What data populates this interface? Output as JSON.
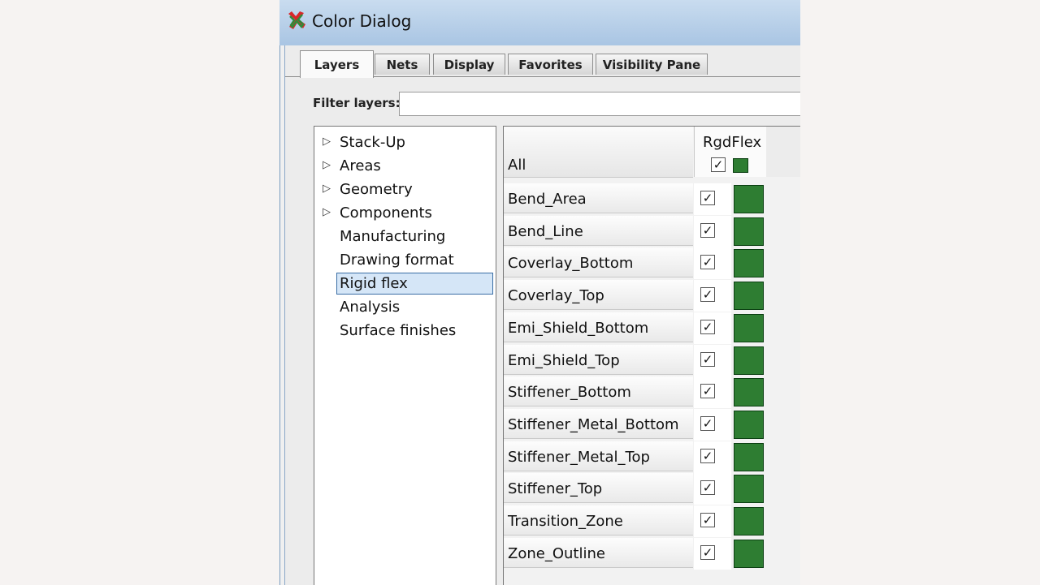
{
  "window": {
    "title": "Color Dialog",
    "icon": "color-palette-icon"
  },
  "tabs": [
    {
      "label": "Layers",
      "active": true
    },
    {
      "label": "Nets",
      "active": false
    },
    {
      "label": "Display",
      "active": false
    },
    {
      "label": "Favorites",
      "active": false
    },
    {
      "label": "Visibility Pane",
      "active": false
    }
  ],
  "filter": {
    "label": "Filter layers:",
    "value": ""
  },
  "tree": {
    "items": [
      {
        "label": "Stack-Up",
        "expandable": true
      },
      {
        "label": "Areas",
        "expandable": true
      },
      {
        "label": "Geometry",
        "expandable": true
      },
      {
        "label": "Components",
        "expandable": true
      },
      {
        "label": "Manufacturing",
        "expandable": false
      },
      {
        "label": "Drawing format",
        "expandable": false
      },
      {
        "label": "Rigid flex",
        "expandable": false,
        "selected": true
      },
      {
        "label": "Analysis",
        "expandable": false
      },
      {
        "label": "Surface finishes",
        "expandable": false
      }
    ]
  },
  "grid": {
    "all_label": "All",
    "column": "RgdFlex",
    "all_checked": true,
    "swatch_color": "#2e7d32",
    "rows": [
      {
        "name": "Bend_Area",
        "checked": true
      },
      {
        "name": "Bend_Line",
        "checked": true
      },
      {
        "name": "Coverlay_Bottom",
        "checked": true
      },
      {
        "name": "Coverlay_Top",
        "checked": true
      },
      {
        "name": "Emi_Shield_Bottom",
        "checked": true
      },
      {
        "name": "Emi_Shield_Top",
        "checked": true
      },
      {
        "name": "Stiffener_Bottom",
        "checked": true
      },
      {
        "name": "Stiffener_Metal_Bottom",
        "checked": true
      },
      {
        "name": "Stiffener_Metal_Top",
        "checked": true
      },
      {
        "name": "Stiffener_Top",
        "checked": true
      },
      {
        "name": "Transition_Zone",
        "checked": true
      },
      {
        "name": "Zone_Outline",
        "checked": true
      }
    ]
  }
}
